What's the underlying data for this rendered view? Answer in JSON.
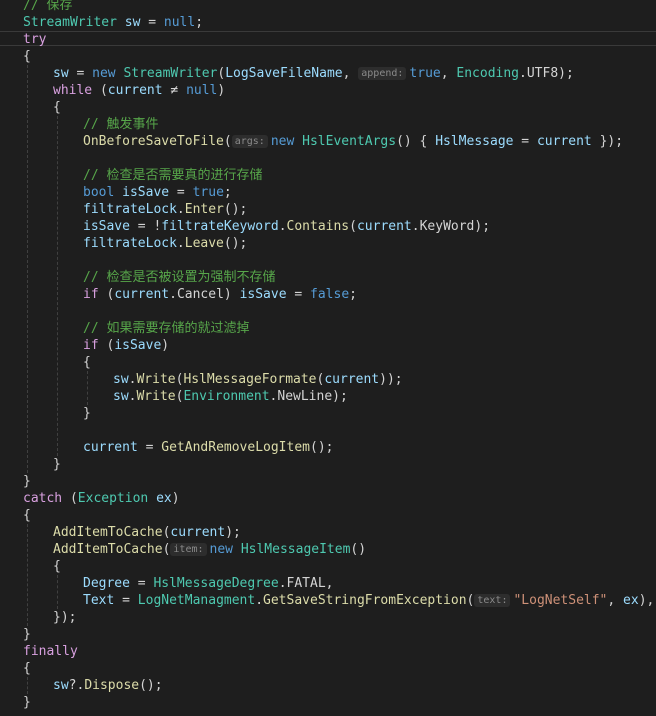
{
  "editor": {
    "colors": {
      "background": "#1e1e1e",
      "keyword": "#569cd6",
      "control": "#d8a0df",
      "type": "#4ec9b0",
      "method": "#dcdcaa",
      "variable": "#9cdcfe",
      "string": "#ce9178",
      "comment": "#57a64a",
      "plain": "#d4d4d4"
    },
    "lines": [
      {
        "indent": 0,
        "tokens": [
          {
            "t": "comment",
            "v": "// 保存"
          }
        ]
      },
      {
        "indent": 0,
        "tokens": [
          {
            "t": "type",
            "v": "StreamWriter"
          },
          {
            "t": "plain",
            "v": " "
          },
          {
            "t": "var",
            "v": "sw"
          },
          {
            "t": "plain",
            "v": " = "
          },
          {
            "t": "kw",
            "v": "null"
          },
          {
            "t": "punc",
            "v": ";"
          }
        ]
      },
      {
        "indent": 0,
        "current": true,
        "tokens": [
          {
            "t": "ctl",
            "v": "try"
          }
        ]
      },
      {
        "indent": 0,
        "tokens": [
          {
            "t": "punc",
            "v": "{"
          }
        ]
      },
      {
        "indent": 1,
        "tokens": [
          {
            "t": "var",
            "v": "sw"
          },
          {
            "t": "plain",
            "v": " = "
          },
          {
            "t": "kw",
            "v": "new"
          },
          {
            "t": "plain",
            "v": " "
          },
          {
            "t": "type",
            "v": "StreamWriter"
          },
          {
            "t": "punc",
            "v": "("
          },
          {
            "t": "var",
            "v": "LogSaveFileName"
          },
          {
            "t": "punc",
            "v": ", "
          },
          {
            "t": "hint",
            "v": "append:"
          },
          {
            "t": "kw",
            "v": "true"
          },
          {
            "t": "punc",
            "v": ", "
          },
          {
            "t": "type",
            "v": "Encoding"
          },
          {
            "t": "punc",
            "v": "."
          },
          {
            "t": "prop",
            "v": "UTF8"
          },
          {
            "t": "punc",
            "v": ");"
          }
        ]
      },
      {
        "indent": 1,
        "tokens": [
          {
            "t": "ctl",
            "v": "while"
          },
          {
            "t": "plain",
            "v": " ("
          },
          {
            "t": "var",
            "v": "current"
          },
          {
            "t": "plain",
            "v": " ≠ "
          },
          {
            "t": "kw",
            "v": "null"
          },
          {
            "t": "punc",
            "v": ")"
          }
        ]
      },
      {
        "indent": 1,
        "tokens": [
          {
            "t": "punc",
            "v": "{"
          }
        ]
      },
      {
        "indent": 2,
        "tokens": [
          {
            "t": "comment",
            "v": "// 触发事件"
          }
        ]
      },
      {
        "indent": 2,
        "tokens": [
          {
            "t": "method",
            "v": "OnBeforeSaveToFile"
          },
          {
            "t": "punc",
            "v": "("
          },
          {
            "t": "hint",
            "v": "args:"
          },
          {
            "t": "kw",
            "v": "new"
          },
          {
            "t": "plain",
            "v": " "
          },
          {
            "t": "type",
            "v": "HslEventArgs"
          },
          {
            "t": "punc",
            "v": "() { "
          },
          {
            "t": "var",
            "v": "HslMessage"
          },
          {
            "t": "plain",
            "v": " = "
          },
          {
            "t": "var",
            "v": "current"
          },
          {
            "t": "punc",
            "v": " });"
          }
        ]
      },
      {
        "indent": 2,
        "tokens": []
      },
      {
        "indent": 2,
        "tokens": [
          {
            "t": "comment",
            "v": "// 检查是否需要真的进行存储"
          }
        ]
      },
      {
        "indent": 2,
        "tokens": [
          {
            "t": "kw",
            "v": "bool"
          },
          {
            "t": "plain",
            "v": " "
          },
          {
            "t": "var",
            "v": "isSave"
          },
          {
            "t": "plain",
            "v": " = "
          },
          {
            "t": "kw",
            "v": "true"
          },
          {
            "t": "punc",
            "v": ";"
          }
        ]
      },
      {
        "indent": 2,
        "tokens": [
          {
            "t": "var",
            "v": "filtrateLock"
          },
          {
            "t": "punc",
            "v": "."
          },
          {
            "t": "method",
            "v": "Enter"
          },
          {
            "t": "punc",
            "v": "();"
          }
        ]
      },
      {
        "indent": 2,
        "tokens": [
          {
            "t": "var",
            "v": "isSave"
          },
          {
            "t": "plain",
            "v": " = !"
          },
          {
            "t": "var",
            "v": "filtrateKeyword"
          },
          {
            "t": "punc",
            "v": "."
          },
          {
            "t": "method",
            "v": "Contains"
          },
          {
            "t": "punc",
            "v": "("
          },
          {
            "t": "var",
            "v": "current"
          },
          {
            "t": "punc",
            "v": "."
          },
          {
            "t": "prop",
            "v": "KeyWord"
          },
          {
            "t": "punc",
            "v": ");"
          }
        ]
      },
      {
        "indent": 2,
        "tokens": [
          {
            "t": "var",
            "v": "filtrateLock"
          },
          {
            "t": "punc",
            "v": "."
          },
          {
            "t": "method",
            "v": "Leave"
          },
          {
            "t": "punc",
            "v": "();"
          }
        ]
      },
      {
        "indent": 2,
        "tokens": []
      },
      {
        "indent": 2,
        "tokens": [
          {
            "t": "comment",
            "v": "// 检查是否被设置为强制不存储"
          }
        ]
      },
      {
        "indent": 2,
        "tokens": [
          {
            "t": "ctl",
            "v": "if"
          },
          {
            "t": "plain",
            "v": " ("
          },
          {
            "t": "var",
            "v": "current"
          },
          {
            "t": "punc",
            "v": "."
          },
          {
            "t": "prop",
            "v": "Cancel"
          },
          {
            "t": "punc",
            "v": ") "
          },
          {
            "t": "var",
            "v": "isSave"
          },
          {
            "t": "plain",
            "v": " = "
          },
          {
            "t": "kw",
            "v": "false"
          },
          {
            "t": "punc",
            "v": ";"
          }
        ]
      },
      {
        "indent": 2,
        "tokens": []
      },
      {
        "indent": 2,
        "tokens": [
          {
            "t": "comment",
            "v": "// 如果需要存储的就过滤掉"
          }
        ]
      },
      {
        "indent": 2,
        "tokens": [
          {
            "t": "ctl",
            "v": "if"
          },
          {
            "t": "plain",
            "v": " ("
          },
          {
            "t": "var",
            "v": "isSave"
          },
          {
            "t": "punc",
            "v": ")"
          }
        ]
      },
      {
        "indent": 2,
        "tokens": [
          {
            "t": "punc",
            "v": "{"
          }
        ]
      },
      {
        "indent": 3,
        "tokens": [
          {
            "t": "var",
            "v": "sw"
          },
          {
            "t": "punc",
            "v": "."
          },
          {
            "t": "method",
            "v": "Write"
          },
          {
            "t": "punc",
            "v": "("
          },
          {
            "t": "method",
            "v": "HslMessageFormate"
          },
          {
            "t": "punc",
            "v": "("
          },
          {
            "t": "var",
            "v": "current"
          },
          {
            "t": "punc",
            "v": "));"
          }
        ]
      },
      {
        "indent": 3,
        "tokens": [
          {
            "t": "var",
            "v": "sw"
          },
          {
            "t": "punc",
            "v": "."
          },
          {
            "t": "method",
            "v": "Write"
          },
          {
            "t": "punc",
            "v": "("
          },
          {
            "t": "type",
            "v": "Environment"
          },
          {
            "t": "punc",
            "v": "."
          },
          {
            "t": "prop",
            "v": "NewLine"
          },
          {
            "t": "punc",
            "v": ");"
          }
        ]
      },
      {
        "indent": 2,
        "tokens": [
          {
            "t": "punc",
            "v": "}"
          }
        ]
      },
      {
        "indent": 2,
        "tokens": []
      },
      {
        "indent": 2,
        "tokens": [
          {
            "t": "var",
            "v": "current"
          },
          {
            "t": "plain",
            "v": " = "
          },
          {
            "t": "method",
            "v": "GetAndRemoveLogItem"
          },
          {
            "t": "punc",
            "v": "();"
          }
        ]
      },
      {
        "indent": 1,
        "tokens": [
          {
            "t": "punc",
            "v": "}"
          }
        ]
      },
      {
        "indent": 0,
        "tokens": [
          {
            "t": "punc",
            "v": "}"
          }
        ]
      },
      {
        "indent": 0,
        "tokens": [
          {
            "t": "ctl",
            "v": "catch"
          },
          {
            "t": "plain",
            "v": " ("
          },
          {
            "t": "type",
            "v": "Exception"
          },
          {
            "t": "plain",
            "v": " "
          },
          {
            "t": "var",
            "v": "ex"
          },
          {
            "t": "punc",
            "v": ")"
          }
        ]
      },
      {
        "indent": 0,
        "tokens": [
          {
            "t": "punc",
            "v": "{"
          }
        ]
      },
      {
        "indent": 1,
        "tokens": [
          {
            "t": "method",
            "v": "AddItemToCache"
          },
          {
            "t": "punc",
            "v": "("
          },
          {
            "t": "var",
            "v": "current"
          },
          {
            "t": "punc",
            "v": ");"
          }
        ]
      },
      {
        "indent": 1,
        "tokens": [
          {
            "t": "method",
            "v": "AddItemToCache"
          },
          {
            "t": "punc",
            "v": "("
          },
          {
            "t": "hint",
            "v": "item:"
          },
          {
            "t": "kw",
            "v": "new"
          },
          {
            "t": "plain",
            "v": " "
          },
          {
            "t": "type",
            "v": "HslMessageItem"
          },
          {
            "t": "punc",
            "v": "()"
          }
        ]
      },
      {
        "indent": 1,
        "tokens": [
          {
            "t": "punc",
            "v": "{"
          }
        ]
      },
      {
        "indent": 2,
        "tokens": [
          {
            "t": "var",
            "v": "Degree"
          },
          {
            "t": "plain",
            "v": " = "
          },
          {
            "t": "type",
            "v": "HslMessageDegree"
          },
          {
            "t": "punc",
            "v": "."
          },
          {
            "t": "prop",
            "v": "FATAL"
          },
          {
            "t": "punc",
            "v": ","
          }
        ]
      },
      {
        "indent": 2,
        "tokens": [
          {
            "t": "var",
            "v": "Text"
          },
          {
            "t": "plain",
            "v": " = "
          },
          {
            "t": "type",
            "v": "LogNetManagment"
          },
          {
            "t": "punc",
            "v": "."
          },
          {
            "t": "method",
            "v": "GetSaveStringFromException"
          },
          {
            "t": "punc",
            "v": "("
          },
          {
            "t": "hint",
            "v": "text:"
          },
          {
            "t": "str",
            "v": "\"LogNetSelf\""
          },
          {
            "t": "punc",
            "v": ", "
          },
          {
            "t": "var",
            "v": "ex"
          },
          {
            "t": "punc",
            "v": "),"
          }
        ]
      },
      {
        "indent": 1,
        "tokens": [
          {
            "t": "punc",
            "v": "});"
          }
        ]
      },
      {
        "indent": 0,
        "tokens": [
          {
            "t": "punc",
            "v": "}"
          }
        ]
      },
      {
        "indent": 0,
        "tokens": [
          {
            "t": "ctl",
            "v": "finally"
          }
        ]
      },
      {
        "indent": 0,
        "tokens": [
          {
            "t": "punc",
            "v": "{"
          }
        ]
      },
      {
        "indent": 1,
        "tokens": [
          {
            "t": "var",
            "v": "sw"
          },
          {
            "t": "plain",
            "v": "?."
          },
          {
            "t": "method",
            "v": "Dispose"
          },
          {
            "t": "punc",
            "v": "();"
          }
        ]
      },
      {
        "indent": 0,
        "tokens": [
          {
            "t": "punc",
            "v": "}"
          }
        ]
      }
    ]
  }
}
